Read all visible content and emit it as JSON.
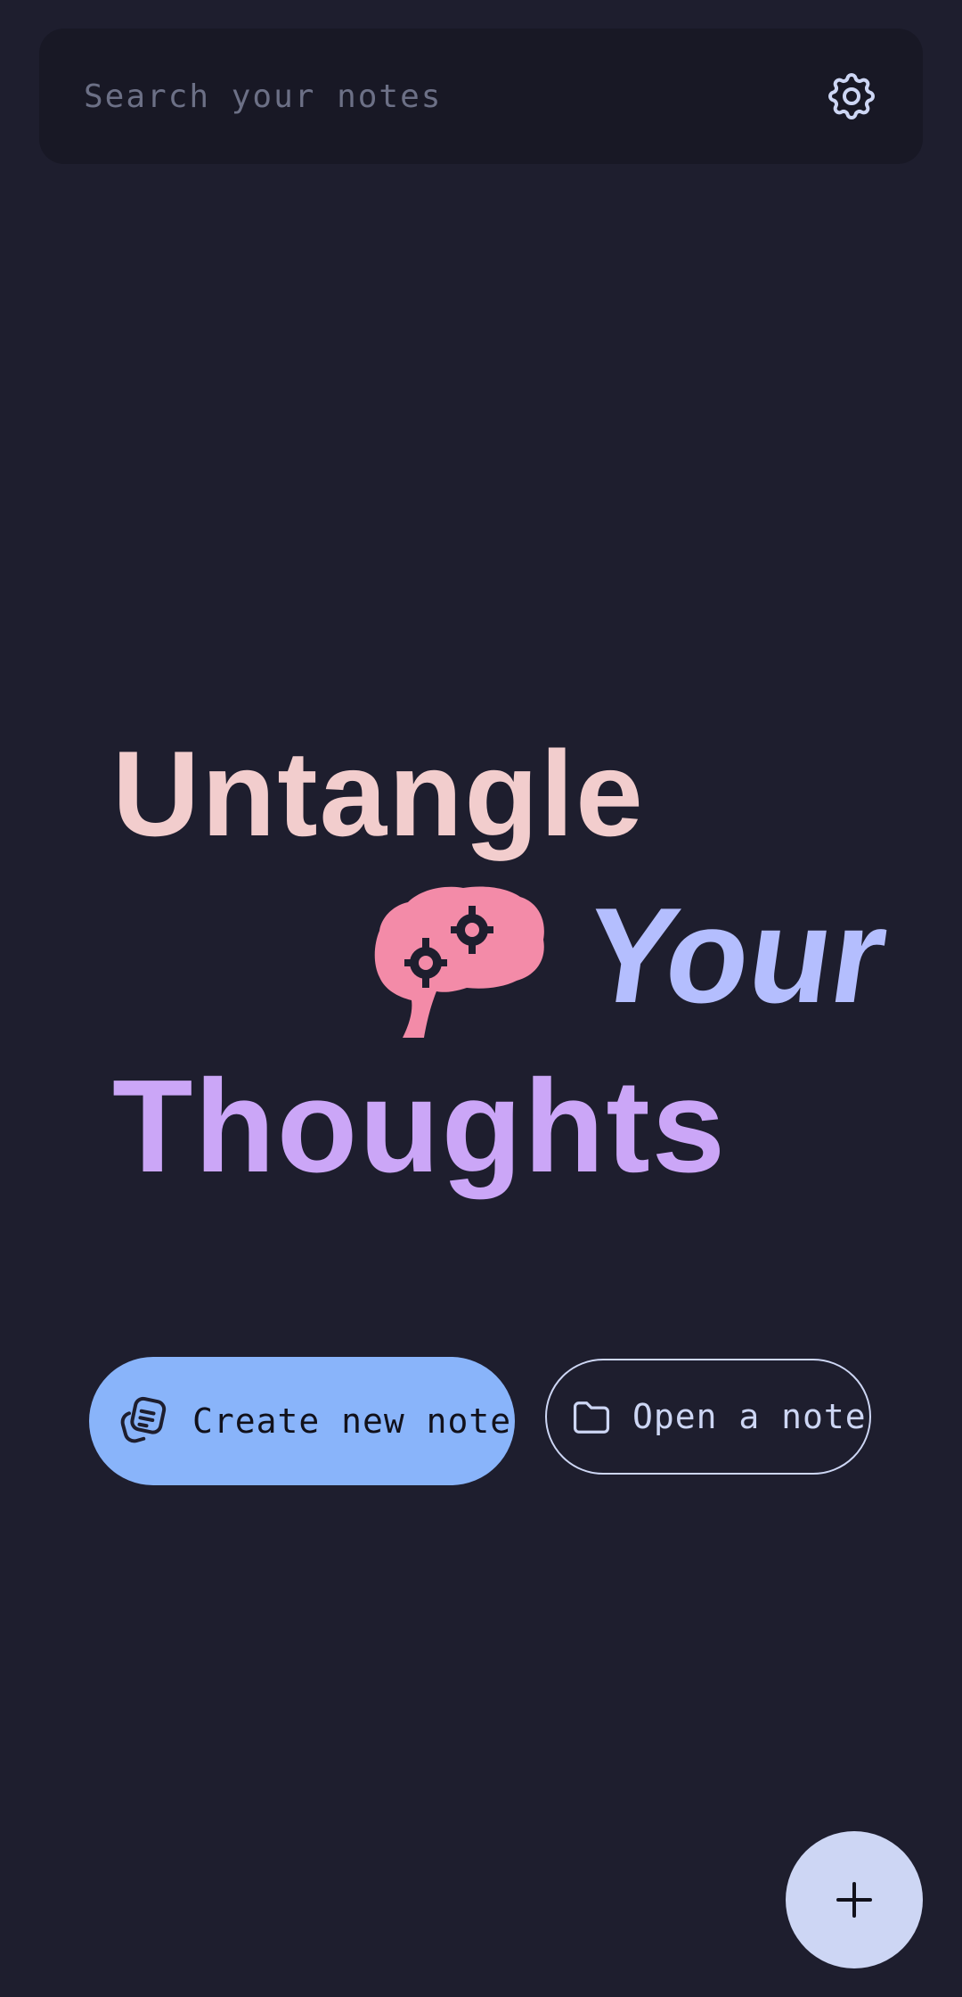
{
  "search": {
    "placeholder": "Search your notes",
    "value": ""
  },
  "header": {
    "settings_icon": "gear-icon"
  },
  "hero": {
    "line1": "Untangle",
    "line2": "Your",
    "line3": "Thoughts",
    "illustration": "brain-with-gears-icon"
  },
  "actions": {
    "create": {
      "label": "Create new note",
      "icon": "notes-icon"
    },
    "open": {
      "label": "Open a note",
      "icon": "folder-icon"
    }
  },
  "fab": {
    "icon": "plus-icon"
  },
  "colors": {
    "background": "#1e1e2e",
    "search_background": "#181825",
    "placeholder_text": "#6c7086",
    "hero_line1": "#f2cdcd",
    "hero_line2": "#b4befe",
    "hero_line3": "#cba6f7",
    "brain": "#f38ba8",
    "create_button": "#89b4fa",
    "outline": "#cdd6f4",
    "fab_background": "#cdd6f4"
  }
}
